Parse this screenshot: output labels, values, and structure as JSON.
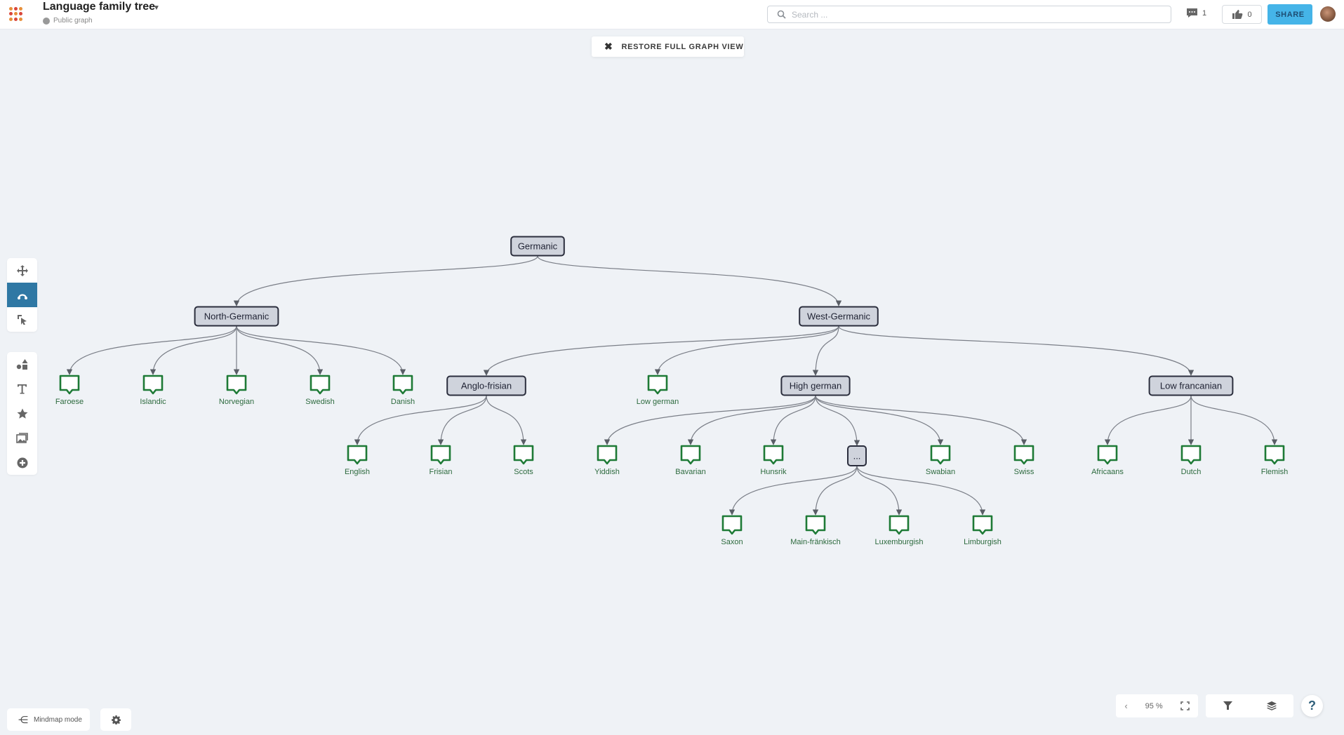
{
  "header": {
    "title": "Language family tree",
    "subtitle": "Public graph",
    "search_placeholder": "Search ...",
    "comments_count": "1",
    "likes_count": "0",
    "share_label": "SHARE"
  },
  "restore_button": {
    "label": "RESTORE FULL GRAPH VIEW"
  },
  "left_toolbar": {
    "group1": [
      {
        "icon": "move-icon",
        "label": "Move"
      },
      {
        "icon": "connect-icon",
        "label": "Connect",
        "active": true
      },
      {
        "icon": "select-icon",
        "label": "Select"
      }
    ],
    "group2": [
      {
        "icon": "shapes-icon",
        "label": "Shapes"
      },
      {
        "icon": "text-icon",
        "label": "Text"
      },
      {
        "icon": "star-icon",
        "label": "Favorites"
      },
      {
        "icon": "image-icon",
        "label": "Image"
      },
      {
        "icon": "add-icon",
        "label": "Add"
      }
    ]
  },
  "bottom_left": {
    "mindmap_label": "Mindmap mode"
  },
  "bottom_right": {
    "zoom_level": "95 %"
  },
  "graph": {
    "nodes": [
      {
        "id": "germanic",
        "label": "Germanic",
        "type": "group"
      },
      {
        "id": "north",
        "label": "North-Germanic",
        "type": "group",
        "parent": "germanic"
      },
      {
        "id": "west",
        "label": "West-Germanic",
        "type": "group",
        "parent": "germanic"
      },
      {
        "id": "faroese",
        "label": "Faroese",
        "type": "leaf",
        "parent": "north"
      },
      {
        "id": "islandic",
        "label": "Islandic",
        "type": "leaf",
        "parent": "north"
      },
      {
        "id": "norvegian",
        "label": "Norvegian",
        "type": "leaf",
        "parent": "north"
      },
      {
        "id": "swedish",
        "label": "Swedish",
        "type": "leaf",
        "parent": "north"
      },
      {
        "id": "danish",
        "label": "Danish",
        "type": "leaf",
        "parent": "north"
      },
      {
        "id": "anglo",
        "label": "Anglo-frisian",
        "type": "group",
        "parent": "west"
      },
      {
        "id": "lowgerman",
        "label": "Low german",
        "type": "leaf",
        "parent": "west"
      },
      {
        "id": "highgerman",
        "label": "High german",
        "type": "group",
        "parent": "west"
      },
      {
        "id": "lowfran",
        "label": "Low francanian",
        "type": "group",
        "parent": "west"
      },
      {
        "id": "english",
        "label": "English",
        "type": "leaf",
        "parent": "anglo"
      },
      {
        "id": "frisian",
        "label": "Frisian",
        "type": "leaf",
        "parent": "anglo"
      },
      {
        "id": "scots",
        "label": "Scots",
        "type": "leaf",
        "parent": "anglo"
      },
      {
        "id": "yiddish",
        "label": "Yiddish",
        "type": "leaf",
        "parent": "highgerman"
      },
      {
        "id": "bavarian",
        "label": "Bavarian",
        "type": "leaf",
        "parent": "highgerman"
      },
      {
        "id": "hunsrik",
        "label": "Hunsrik",
        "type": "leaf",
        "parent": "highgerman"
      },
      {
        "id": "more",
        "label": "...",
        "type": "group",
        "parent": "highgerman"
      },
      {
        "id": "swabian",
        "label": "Swabian",
        "type": "leaf",
        "parent": "highgerman"
      },
      {
        "id": "swiss",
        "label": "Swiss",
        "type": "leaf",
        "parent": "highgerman"
      },
      {
        "id": "africaans",
        "label": "Africaans",
        "type": "leaf",
        "parent": "lowfran"
      },
      {
        "id": "dutch",
        "label": "Dutch",
        "type": "leaf",
        "parent": "lowfran"
      },
      {
        "id": "flemish",
        "label": "Flemish",
        "type": "leaf",
        "parent": "lowfran"
      },
      {
        "id": "saxon",
        "label": "Saxon",
        "type": "leaf",
        "parent": "more"
      },
      {
        "id": "mainfrank",
        "label": "Main-fränkisch",
        "type": "leaf",
        "parent": "more"
      },
      {
        "id": "luxemb",
        "label": "Luxemburgish",
        "type": "leaf",
        "parent": "more"
      },
      {
        "id": "limburg",
        "label": "Limburgish",
        "type": "leaf",
        "parent": "more"
      }
    ]
  },
  "colors": {
    "accent": "#45b4e8",
    "active_tool": "#2f78a4",
    "leaf": "#1e7a36",
    "group_fill": "#cfd3dc"
  }
}
